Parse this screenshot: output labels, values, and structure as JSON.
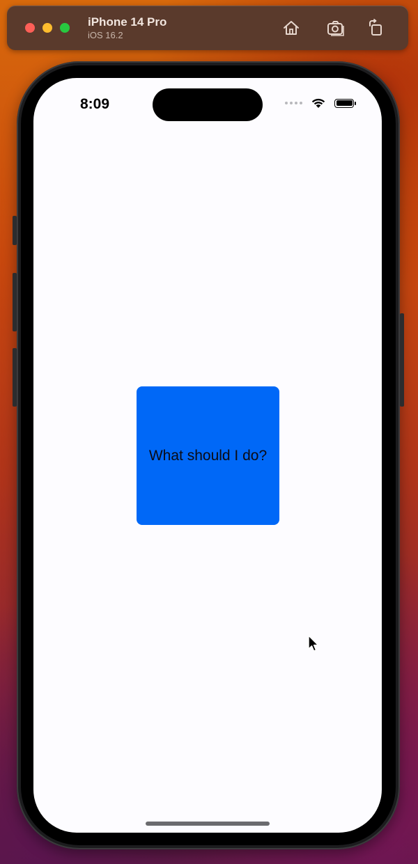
{
  "window": {
    "device_name": "iPhone 14 Pro",
    "os_version": "iOS 16.2",
    "toolbar_icons": [
      "home-icon",
      "screenshot-icon",
      "rotate-icon"
    ]
  },
  "status_bar": {
    "time": "8:09",
    "icons": [
      "cellular-dots-icon",
      "wifi-icon",
      "battery-icon"
    ]
  },
  "app": {
    "button_label": "What should I do?",
    "button_color": "#0068f7",
    "background_color": "#fdfcff"
  }
}
